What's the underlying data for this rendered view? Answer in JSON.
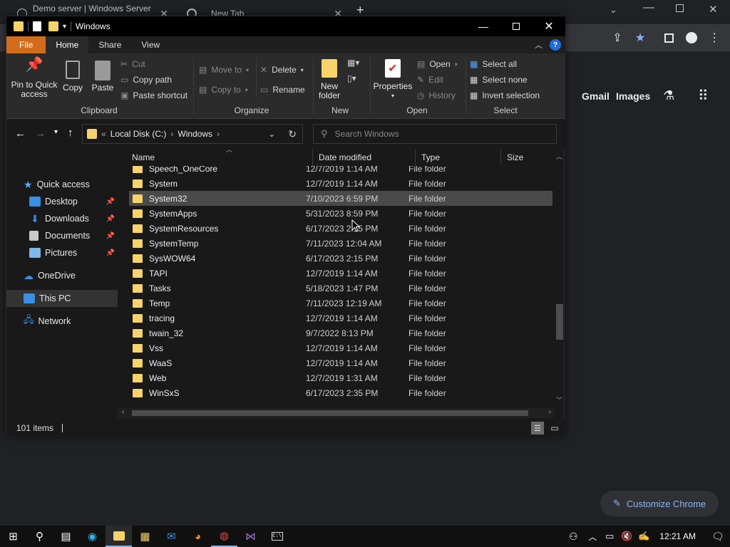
{
  "chrome": {
    "tabs": [
      {
        "label": "Demo server | Windows Server |"
      },
      {
        "label": "New Tab"
      }
    ],
    "ntp_links": {
      "gmail": "Gmail",
      "images": "Images"
    },
    "customize_label": "Customize Chrome"
  },
  "explorer": {
    "title": "Windows",
    "ribbon_tabs": [
      "File",
      "Home",
      "Share",
      "View"
    ],
    "clipboard": {
      "pin": "Pin to Quick access",
      "copy": "Copy",
      "paste": "Paste",
      "cut": "Cut",
      "copy_path": "Copy path",
      "paste_shortcut": "Paste shortcut",
      "label": "Clipboard"
    },
    "organize": {
      "move_to": "Move to",
      "copy_to": "Copy to",
      "delete": "Delete",
      "rename": "Rename",
      "label": "Organize"
    },
    "new": {
      "new_folder": "New folder",
      "label": "New"
    },
    "open": {
      "properties": "Properties",
      "open": "Open",
      "edit": "Edit",
      "history": "History",
      "label": "Open"
    },
    "select": {
      "select_all": "Select all",
      "select_none": "Select none",
      "invert": "Invert selection",
      "label": "Select"
    },
    "address": {
      "crumb1": "Local Disk (C:)",
      "crumb2": "Windows"
    },
    "search_placeholder": "Search Windows",
    "nav": {
      "quick_access": "Quick access",
      "desktop": "Desktop",
      "downloads": "Downloads",
      "documents": "Documents",
      "pictures": "Pictures",
      "onedrive": "OneDrive",
      "this_pc": "This PC",
      "network": "Network"
    },
    "columns": {
      "name": "Name",
      "date": "Date modified",
      "type": "Type",
      "size": "Size"
    },
    "rows": [
      {
        "name": "Speech_OneCore",
        "date": "12/7/2019 1:14 AM",
        "type": "File folder"
      },
      {
        "name": "System",
        "date": "12/7/2019 1:14 AM",
        "type": "File folder"
      },
      {
        "name": "System32",
        "date": "7/10/2023 6:59 PM",
        "type": "File folder"
      },
      {
        "name": "SystemApps",
        "date": "5/31/2023 8:59 PM",
        "type": "File folder"
      },
      {
        "name": "SystemResources",
        "date": "6/17/2023 2:15 PM",
        "type": "File folder"
      },
      {
        "name": "SystemTemp",
        "date": "7/11/2023 12:04 AM",
        "type": "File folder"
      },
      {
        "name": "SysWOW64",
        "date": "6/17/2023 2:15 PM",
        "type": "File folder"
      },
      {
        "name": "TAPI",
        "date": "12/7/2019 1:14 AM",
        "type": "File folder"
      },
      {
        "name": "Tasks",
        "date": "5/18/2023 1:47 PM",
        "type": "File folder"
      },
      {
        "name": "Temp",
        "date": "7/11/2023 12:19 AM",
        "type": "File folder"
      },
      {
        "name": "tracing",
        "date": "12/7/2019 1:14 AM",
        "type": "File folder"
      },
      {
        "name": "twain_32",
        "date": "9/7/2022 8:13 PM",
        "type": "File folder"
      },
      {
        "name": "Vss",
        "date": "12/7/2019 1:14 AM",
        "type": "File folder"
      },
      {
        "name": "WaaS",
        "date": "12/7/2019 1:14 AM",
        "type": "File folder"
      },
      {
        "name": "Web",
        "date": "12/7/2019 1:31 AM",
        "type": "File folder"
      },
      {
        "name": "WinSxS",
        "date": "6/17/2023 2:35 PM",
        "type": "File folder"
      }
    ],
    "status": "101 items"
  },
  "taskbar": {
    "time": "12:21 AM"
  }
}
